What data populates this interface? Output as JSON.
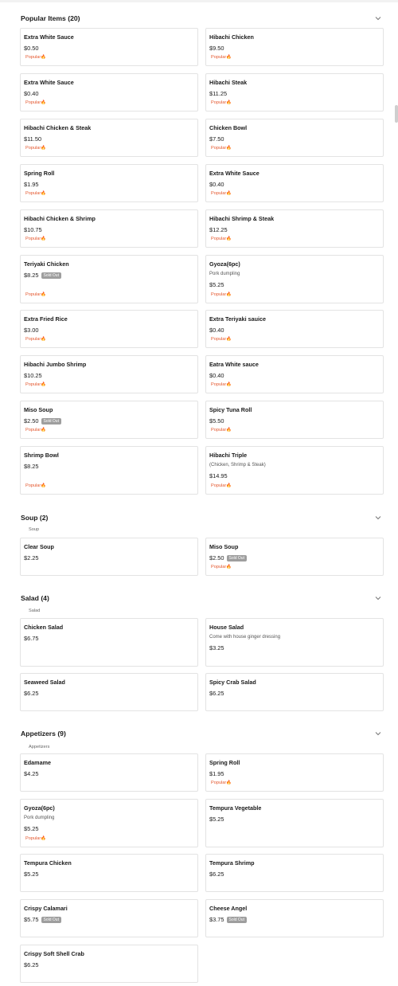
{
  "sections": {
    "popular": {
      "title": "Popular Items (20)",
      "subtitle": ""
    },
    "soup": {
      "title": "Soup (2)",
      "subtitle": "Soup"
    },
    "salad": {
      "title": "Salad (4)",
      "subtitle": "Salad"
    },
    "appetizers": {
      "title": "Appetizers (9)",
      "subtitle": "Appetizers"
    }
  },
  "labels": {
    "popular": "Popular",
    "popular_icon": "fire-icon",
    "sold_out": "Sold Out",
    "chevron_icon": "chevron-down-icon"
  },
  "items": [
    {
      "section": "popular",
      "name": "Extra White Sauce",
      "price": "$0.50",
      "popular": true
    },
    {
      "section": "popular",
      "name": "Hibachi Chicken",
      "price": "$9.50",
      "popular": true
    },
    {
      "section": "popular",
      "name": "Extra White Sauce",
      "price": "$0.40",
      "popular": true
    },
    {
      "section": "popular",
      "name": "Hibachi Steak",
      "price": "$11.25",
      "popular": true
    },
    {
      "section": "popular",
      "name": "Hibachi Chicken & Steak",
      "price": "$11.50",
      "popular": true
    },
    {
      "section": "popular",
      "name": "Chicken Bowl",
      "price": "$7.50",
      "popular": true
    },
    {
      "section": "popular",
      "name": "Spring Roll",
      "price": "$1.95",
      "popular": true
    },
    {
      "section": "popular",
      "name": "Extra White Sauce",
      "price": "$0.40",
      "popular": true
    },
    {
      "section": "popular",
      "name": "Hibachi Chicken & Shrimp",
      "price": "$10.75",
      "popular": true
    },
    {
      "section": "popular",
      "name": "Hibachi Shrimp & Steak",
      "price": "$12.25",
      "popular": true
    },
    {
      "section": "popular",
      "name": "Teriyaki Chicken",
      "price": "$8.25",
      "sold_out": true,
      "popular": true
    },
    {
      "section": "popular",
      "name": "Gyoza(6pc)",
      "desc": "Pork dumpling",
      "price": "$5.25",
      "popular": true
    },
    {
      "section": "popular",
      "name": "Extra Fried Rice",
      "price": "$3.00",
      "popular": true
    },
    {
      "section": "popular",
      "name": "Extra Teriyaki sauice",
      "price": "$0.40",
      "popular": true
    },
    {
      "section": "popular",
      "name": "Hibachi Jumbo Shrimp",
      "price": "$10.25",
      "popular": true
    },
    {
      "section": "popular",
      "name": "Eatra White sauce",
      "price": "$0.40",
      "popular": true
    },
    {
      "section": "popular",
      "name": "Miso Soup",
      "price": "$2.50",
      "sold_out": true,
      "popular": true
    },
    {
      "section": "popular",
      "name": "Spicy Tuna Roll",
      "price": "$5.50",
      "popular": true
    },
    {
      "section": "popular",
      "name": "Shrimp Bowl",
      "price": "$8.25",
      "popular": true
    },
    {
      "section": "popular",
      "name": "Hibachi Triple",
      "desc": "(Chicken, Shrimp & Steak)",
      "price": "$14.95",
      "popular": true
    },
    {
      "section": "soup",
      "name": "Clear Soup",
      "price": "$2.25"
    },
    {
      "section": "soup",
      "name": "Miso Soup",
      "price": "$2.50",
      "sold_out": true,
      "popular": true
    },
    {
      "section": "salad",
      "name": "Chicken Salad",
      "price": "$6.75"
    },
    {
      "section": "salad",
      "name": "House Salad",
      "desc": "Come with house ginger dressing",
      "price": "$3.25"
    },
    {
      "section": "salad",
      "name": "Seaweed Salad",
      "price": "$6.25"
    },
    {
      "section": "salad",
      "name": "Spicy Crab Salad",
      "price": "$6.25"
    },
    {
      "section": "appetizers",
      "name": "Edamame",
      "price": "$4.25"
    },
    {
      "section": "appetizers",
      "name": "Spring Roll",
      "price": "$1.95",
      "popular": true
    },
    {
      "section": "appetizers",
      "name": "Gyoza(6pc)",
      "desc": "Pork dumpling",
      "price": "$5.25",
      "popular": true
    },
    {
      "section": "appetizers",
      "name": "Tempura Vegetable",
      "price": "$5.25"
    },
    {
      "section": "appetizers",
      "name": "Tempura Chicken",
      "price": "$5.25"
    },
    {
      "section": "appetizers",
      "name": "Tempura Shrimp",
      "price": "$6.25"
    },
    {
      "section": "appetizers",
      "name": "Crispy Calamari",
      "price": "$5.75",
      "sold_out": true
    },
    {
      "section": "appetizers",
      "name": "Cheese Angel",
      "price": "$3.75",
      "sold_out": true
    },
    {
      "section": "appetizers",
      "name": "Crispy Soft Shell Crab",
      "price": "$6.25"
    }
  ]
}
